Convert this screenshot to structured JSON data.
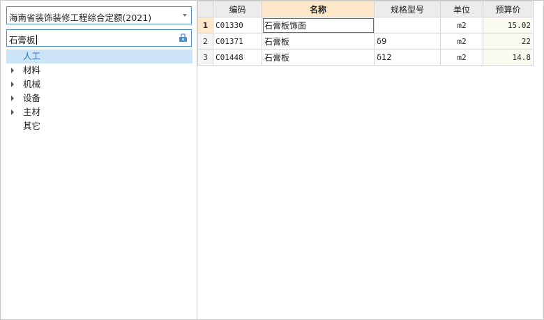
{
  "library": {
    "selected": "海南省装饰装修工程综合定额(2021)"
  },
  "search": {
    "value": "石膏板"
  },
  "tree": [
    {
      "label": "人工",
      "expandable": false,
      "selected": true
    },
    {
      "label": "材料",
      "expandable": true,
      "selected": false
    },
    {
      "label": "机械",
      "expandable": true,
      "selected": false
    },
    {
      "label": "设备",
      "expandable": true,
      "selected": false
    },
    {
      "label": "主材",
      "expandable": true,
      "selected": false
    },
    {
      "label": "其它",
      "expandable": false,
      "selected": false
    }
  ],
  "table": {
    "columns": [
      "",
      "编码",
      "名称",
      "规格型号",
      "单位",
      "预算价"
    ],
    "rows": [
      {
        "num": "1",
        "code": "C01330",
        "name": "石膏板饰面",
        "spec": "",
        "unit": "m2",
        "price": "15.02"
      },
      {
        "num": "2",
        "code": "C01371",
        "name": "石膏板",
        "spec": "δ9",
        "unit": "m2",
        "price": "22"
      },
      {
        "num": "3",
        "code": "C01448",
        "name": "石膏板",
        "spec": "δ12",
        "unit": "m2",
        "price": "14.8"
      }
    ]
  },
  "colors": {
    "accent": "#4a90d9",
    "selection": "#cce4f7",
    "active_header": "#fde7c8"
  }
}
